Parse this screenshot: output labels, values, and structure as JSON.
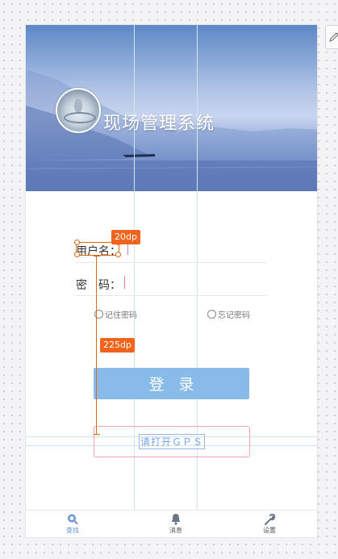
{
  "header": {
    "title": "现场管理系统"
  },
  "login_form": {
    "username_label": "用户名：",
    "password_label": "密　码：",
    "remember_label": "记住密码",
    "forget_label": "忘记密码",
    "login_label": "登 录",
    "gps_label": "请打开ＧＰＳ"
  },
  "annotations": {
    "label_width": "20dp",
    "gps_offset": "225dp"
  },
  "tabbar": {
    "items": [
      {
        "label": "查找",
        "icon": "search-icon",
        "active": true
      },
      {
        "label": "消息",
        "icon": "bell-icon",
        "active": false
      },
      {
        "label": "设置",
        "icon": "wrench-icon",
        "active": false
      }
    ]
  },
  "colors": {
    "annotation": "#f0651b",
    "login_button": "#89bbe9",
    "active_tab": "#6b93d6"
  }
}
